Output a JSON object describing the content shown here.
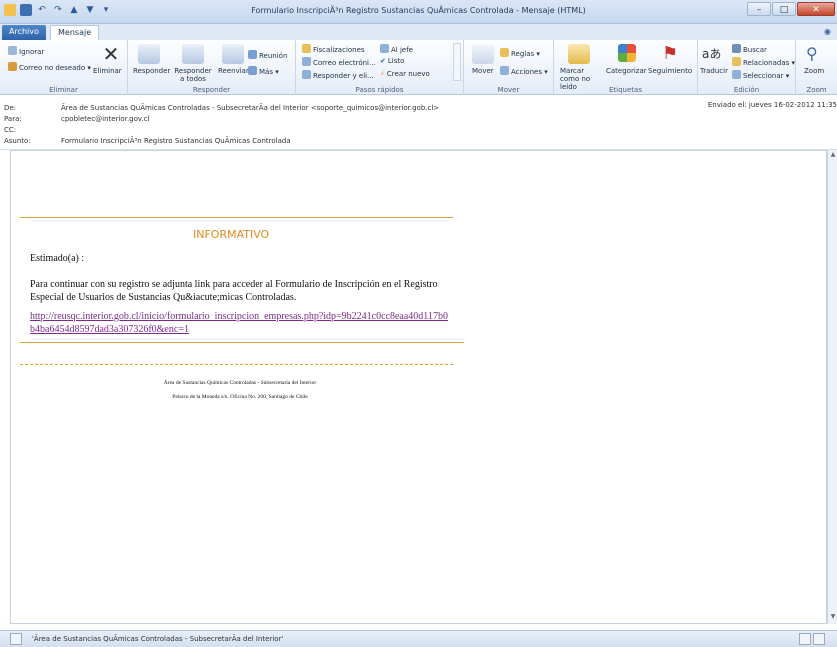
{
  "window": {
    "title": "Formulario InscripciÃ³n Registro Sustancias QuÃ­micas Controlada - Mensaje (HTML)"
  },
  "tabs": {
    "file": "Archivo",
    "message": "Mensaje"
  },
  "ribbon": {
    "eliminar": {
      "ignore": "Ignorar",
      "junk": "Correo no deseado",
      "delete": "Eliminar",
      "label": "Eliminar"
    },
    "responder": {
      "reply": "Responder",
      "reply_all": "Responder a todos",
      "forward": "Reenviar",
      "meeting": "Reunión",
      "more": "Más",
      "label": "Responder"
    },
    "pasos": {
      "items": [
        "Fiscalizaciones",
        "Correo electróni...",
        "Responder y eli...",
        "Al jefe",
        "Listo",
        "Crear nuevo"
      ],
      "label": "Pasos rápidos"
    },
    "mover": {
      "move": "Mover",
      "rules": "Reglas",
      "actions": "Acciones",
      "label": "Mover"
    },
    "etiquetas": {
      "mark_unread": "Marcar como no leído",
      "categorize": "Categorizar",
      "followup": "Seguimiento",
      "label": "Etiquetas"
    },
    "edicion": {
      "translate": "Traducir",
      "find": "Buscar",
      "related": "Relacionadas",
      "select": "Seleccionar",
      "label": "Edición"
    },
    "zoom": {
      "zoom": "Zoom",
      "label": "Zoom"
    }
  },
  "header": {
    "from_label": "De:",
    "from": "Ãrea de Sustancias QuÃ­micas Controladas - SubsecretarÃ­a del Interior <soporte_quimicos@interior.gob.cl>",
    "to_label": "Para:",
    "to": "cpobletec@interior.gov.cl",
    "cc_label": "CC:",
    "cc": "",
    "subject_label": "Asunto:",
    "subject": "Formulario InscripciÃ³n Registro Sustancias QuÃ­micas Controlada",
    "sent_label": "Enviado el:",
    "sent": "jueves 16-02-2012 11:35"
  },
  "body": {
    "heading": "INFORMATIVO",
    "greeting": "Estimado(a) :",
    "paragraph": "Para continuar con su registro se adjunta link para acceder al Formulario de Inscripción en el Registro Especial de Usuarios de Sustancias Qu&iacute;micas Controladas.",
    "link": "http://reusqc.interior.gob.cl/inicio/formulario_inscripcion_empresas.php?idp=9b2241c0cc8eaa40d117b0b4ba6454d8597dad3a307326f0&enc=1",
    "footer_line1": "Área de Sustancias Químicas Controladas - Subsecretaría del Interior",
    "footer_line2": "Palacio de la Moneda s/n. Oficina No. 200, Santiago de Chile"
  },
  "status": {
    "sender": "'Ãrea de Sustancias QuÃ­micas Controladas - SubsecretarÃ­a del Interior'"
  },
  "colors": {
    "accent_orange": "#e08a1e",
    "link_purple": "#7b2a8a",
    "file_tab": "#2d62a8"
  }
}
